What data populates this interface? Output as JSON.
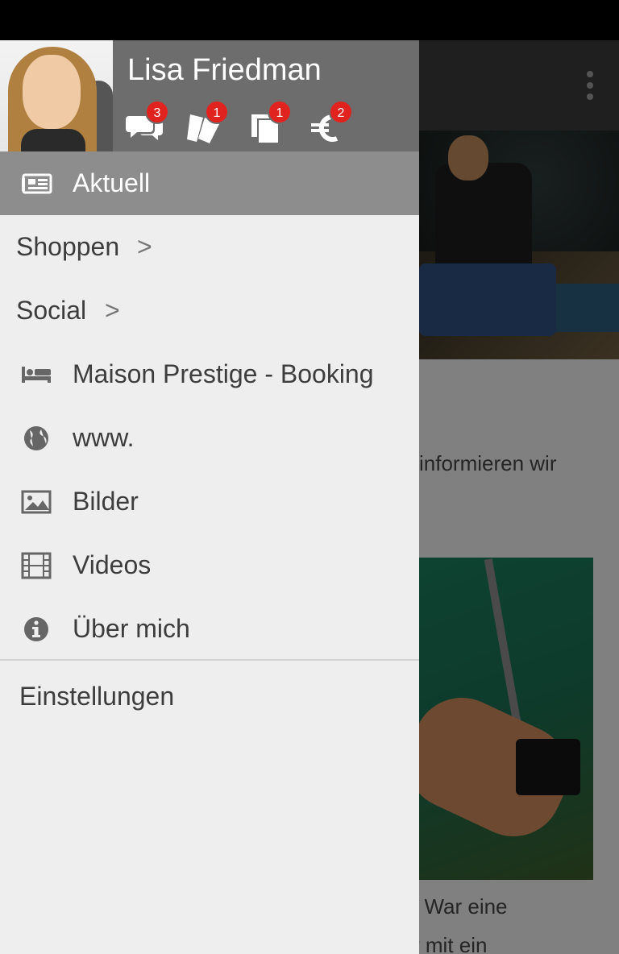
{
  "user": {
    "name": "Lisa Friedman"
  },
  "header_icons": [
    {
      "icon": "chat-bubbles-icon",
      "badge": "3"
    },
    {
      "icon": "tickets-icon",
      "badge": "1"
    },
    {
      "icon": "documents-icon",
      "badge": "1"
    },
    {
      "icon": "euro-icon",
      "badge": "2"
    }
  ],
  "nav": {
    "items": [
      {
        "label": "Aktuell",
        "icon": "newspaper-icon",
        "active": true
      },
      {
        "label": "Shoppen",
        "chevron": ">"
      },
      {
        "label": "Social",
        "chevron": ">"
      },
      {
        "label": "Maison Prestige - Booking",
        "icon": "bed-icon"
      },
      {
        "label": "www.",
        "icon": "globe-icon"
      },
      {
        "label": "Bilder",
        "icon": "image-icon"
      },
      {
        "label": "Videos",
        "icon": "film-icon"
      },
      {
        "label": "Über mich",
        "icon": "info-icon"
      }
    ],
    "settings_label": "Einstellungen"
  },
  "background": {
    "text_1": "informieren wir",
    "text_1b": ".",
    "text_2": ". War eine",
    "text_3": "r mit ein"
  },
  "colors": {
    "drawer_header": "#6d6d6d",
    "active_item": "#8d8d8d",
    "badge": "#e0231e",
    "drawer_bg": "#eeeeee"
  }
}
